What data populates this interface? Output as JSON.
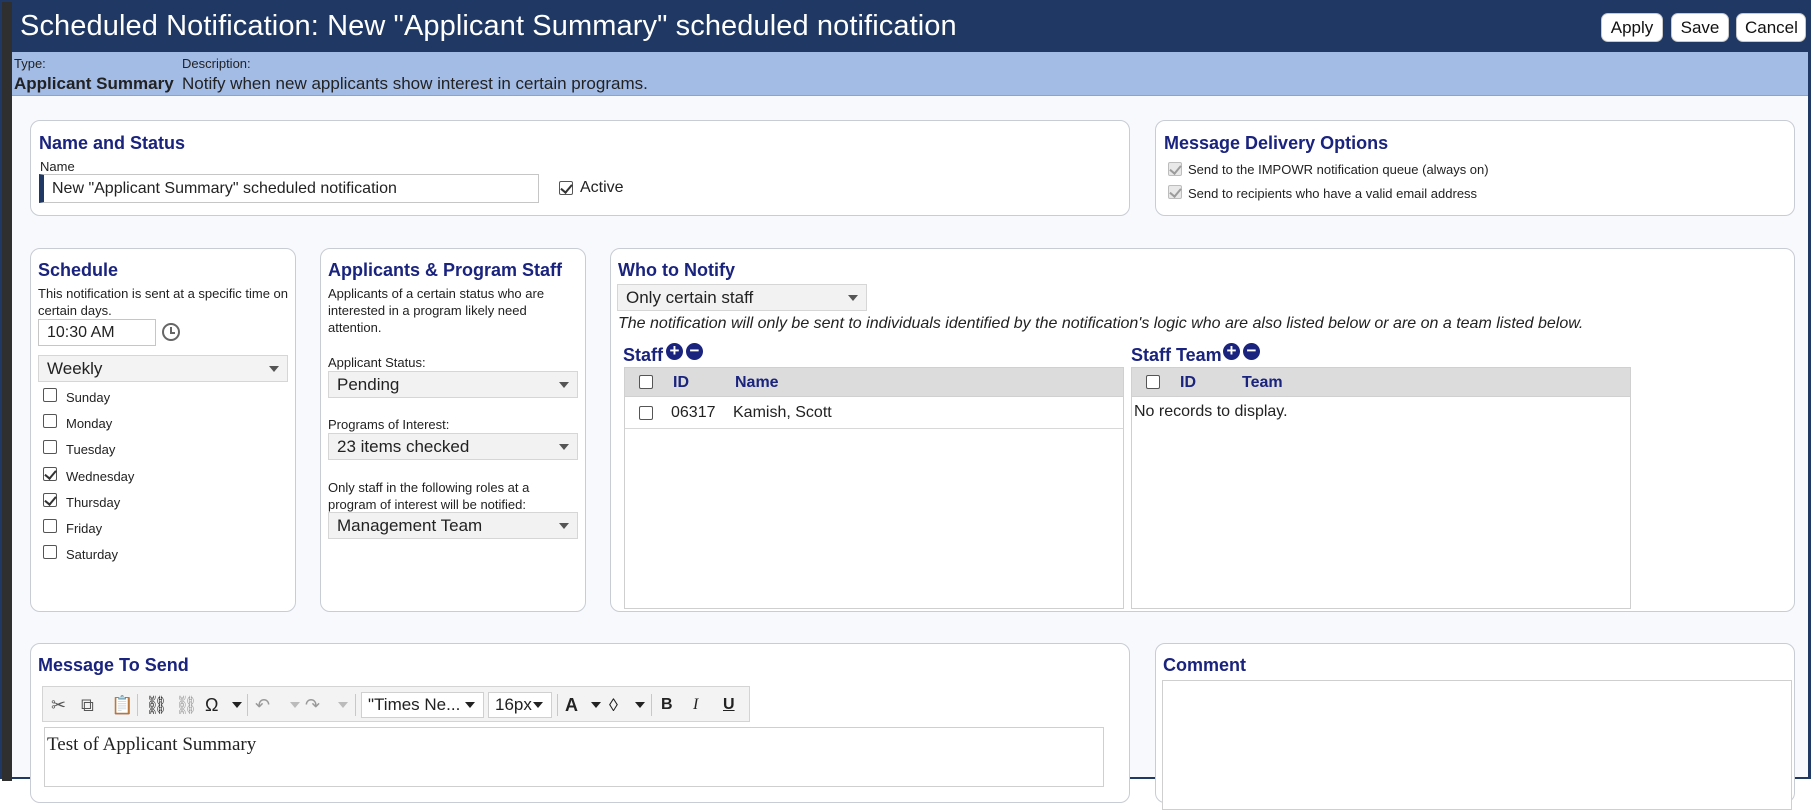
{
  "header": {
    "title": "Scheduled Notification: New \"Applicant Summary\" scheduled notification",
    "apply_label": "Apply",
    "save_label": "Save",
    "cancel_label": "Cancel"
  },
  "info": {
    "type_label": "Type:",
    "type_value": "Applicant Summary",
    "description_label": "Description:",
    "description_value": "Notify when new applicants show interest in certain programs."
  },
  "name_status": {
    "title": "Name and Status",
    "name_label": "Name",
    "name_value": "New \"Applicant Summary\" scheduled notification",
    "active_label": "Active",
    "active_checked": true
  },
  "delivery": {
    "title": "Message Delivery Options",
    "option1": "Send to the IMPOWR notification queue (always on)",
    "option2": "Send to recipients who have a valid email address"
  },
  "schedule": {
    "title": "Schedule",
    "description": "This notification is sent at a specific time on certain days.",
    "time": "10:30 AM",
    "frequency": "Weekly",
    "days": [
      {
        "label": "Sunday",
        "checked": false
      },
      {
        "label": "Monday",
        "checked": false
      },
      {
        "label": "Tuesday",
        "checked": false
      },
      {
        "label": "Wednesday",
        "checked": true
      },
      {
        "label": "Thursday",
        "checked": true
      },
      {
        "label": "Friday",
        "checked": false
      },
      {
        "label": "Saturday",
        "checked": false
      }
    ]
  },
  "applicants": {
    "title": "Applicants & Program Staff",
    "description": "Applicants of a certain status who are interested in a program likely need attention.",
    "status_label": "Applicant Status:",
    "status_value": "Pending",
    "programs_label": "Programs of Interest:",
    "programs_value": "23 items checked",
    "roles_label": "Only staff in the following roles at a program of interest will be notified:",
    "roles_value": "Management Team"
  },
  "who": {
    "title": "Who to Notify",
    "mode": "Only certain staff",
    "note": "The notification will only be sent to individuals identified by the notification's logic who are also listed below or are on a team listed below.",
    "staff_title": "Staff",
    "staff_cols": {
      "id": "ID",
      "name": "Name"
    },
    "staff_rows": [
      {
        "id": "06317",
        "name": "Kamish, Scott"
      }
    ],
    "team_title": "Staff Team",
    "team_cols": {
      "id": "ID",
      "team": "Team"
    },
    "team_empty": "No records to display."
  },
  "message": {
    "title": "Message To Send",
    "font_family": "\"Times Ne...",
    "font_size": "16px",
    "body": "Test of Applicant Summary"
  },
  "comment": {
    "title": "Comment"
  },
  "colors": {
    "header_bg": "#1f3864",
    "info_bg": "#a3bce6",
    "heading": "#1a237e"
  }
}
